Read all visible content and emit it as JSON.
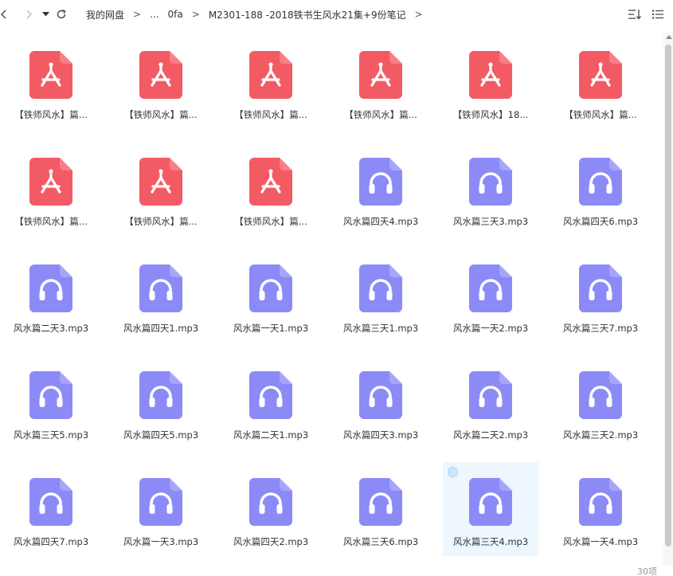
{
  "toolbar": {
    "back_icon": "chevron-left-icon",
    "forward_icon": "chevron-right-icon",
    "history_icon": "caret-down-icon",
    "refresh_icon": "refresh-icon",
    "sort_icon": "sort-icon",
    "view_icon": "list-view-icon"
  },
  "breadcrumb": {
    "items": [
      "我的网盘",
      "...",
      "0fa",
      "M2301-188 -2018铁书生风水21集+9份笔记"
    ],
    "separator": ">"
  },
  "files": [
    {
      "name": "【铁师风水】篇...",
      "type": "pdf"
    },
    {
      "name": "【铁师风水】篇...",
      "type": "pdf"
    },
    {
      "name": "【铁师风水】篇...",
      "type": "pdf"
    },
    {
      "name": "【铁师风水】篇...",
      "type": "pdf"
    },
    {
      "name": "【铁师风水】18...",
      "type": "pdf"
    },
    {
      "name": "【铁师风水】篇...",
      "type": "pdf"
    },
    {
      "name": "【铁师风水】篇...",
      "type": "pdf"
    },
    {
      "name": "【铁师风水】篇...",
      "type": "pdf"
    },
    {
      "name": "【铁师风水】篇...",
      "type": "pdf"
    },
    {
      "name": "风水篇四天4.mp3",
      "type": "mp3"
    },
    {
      "name": "风水篇三天3.mp3",
      "type": "mp3"
    },
    {
      "name": "风水篇四天6.mp3",
      "type": "mp3"
    },
    {
      "name": "风水篇二天3.mp3",
      "type": "mp3"
    },
    {
      "name": "风水篇四天1.mp3",
      "type": "mp3"
    },
    {
      "name": "风水篇一天1.mp3",
      "type": "mp3"
    },
    {
      "name": "风水篇三天1.mp3",
      "type": "mp3"
    },
    {
      "name": "风水篇一天2.mp3",
      "type": "mp3"
    },
    {
      "name": "风水篇三天7.mp3",
      "type": "mp3"
    },
    {
      "name": "风水篇三天5.mp3",
      "type": "mp3"
    },
    {
      "name": "风水篇四天5.mp3",
      "type": "mp3"
    },
    {
      "name": "风水篇二天1.mp3",
      "type": "mp3"
    },
    {
      "name": "风水篇四天3.mp3",
      "type": "mp3"
    },
    {
      "name": "风水篇二天2.mp3",
      "type": "mp3"
    },
    {
      "name": "风水篇三天2.mp3",
      "type": "mp3"
    },
    {
      "name": "风水篇四天7.mp3",
      "type": "mp3"
    },
    {
      "name": "风水篇一天3.mp3",
      "type": "mp3"
    },
    {
      "name": "风水篇四天2.mp3",
      "type": "mp3"
    },
    {
      "name": "风水篇三天6.mp3",
      "type": "mp3"
    },
    {
      "name": "风水篇三天4.mp3",
      "type": "mp3",
      "selected": true
    },
    {
      "name": "风水篇一天4.mp3",
      "type": "mp3"
    }
  ],
  "status": {
    "count": "30项"
  },
  "colors": {
    "pdf_icon": "#f25b63",
    "pdf_icon_top": "#f97f86",
    "mp3_icon": "#8c8af7",
    "mp3_icon_top": "#a7a5fb",
    "selected_bg": "#eef7fe"
  }
}
